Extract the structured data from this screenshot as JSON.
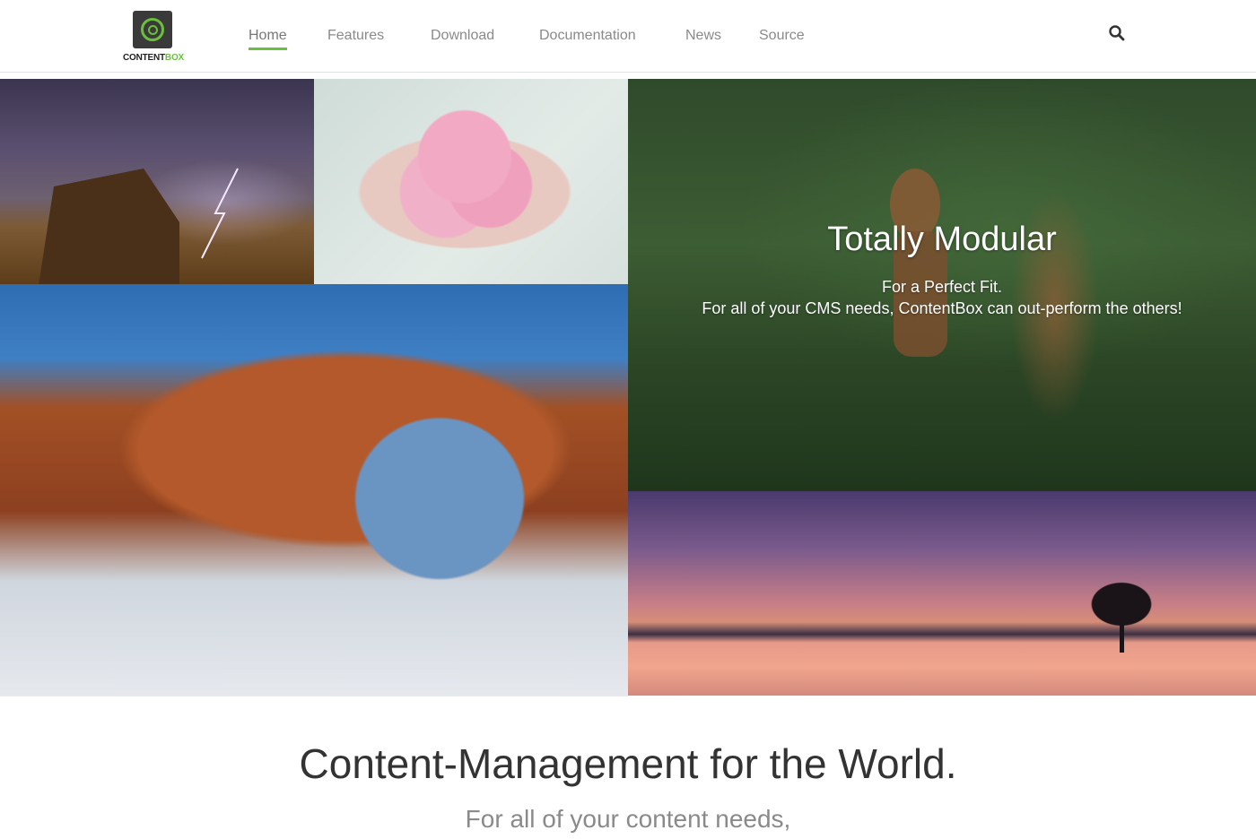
{
  "header": {
    "logo": {
      "part1": "CONTENT",
      "part2": "BOX"
    },
    "nav": [
      {
        "label": "Home",
        "active": true
      },
      {
        "label": "Features",
        "active": false
      },
      {
        "label": "Download",
        "active": false
      },
      {
        "label": "Documentation",
        "active": false
      },
      {
        "label": "News",
        "active": false
      },
      {
        "label": "Source",
        "active": false
      }
    ],
    "search_icon": "search-icon"
  },
  "hero": {
    "title": "Totally Modular",
    "line1": "For a Perfect Fit.",
    "line2": "For all of your CMS needs, ContentBox can out-perform the others!"
  },
  "main": {
    "headline": "Content-Management for the World.",
    "subheadline": "For all of your content needs,"
  },
  "colors": {
    "accent": "#6abf3d",
    "nav_text": "#8a8a8a",
    "headline": "#333333",
    "subheadline": "#8a8a8a"
  }
}
